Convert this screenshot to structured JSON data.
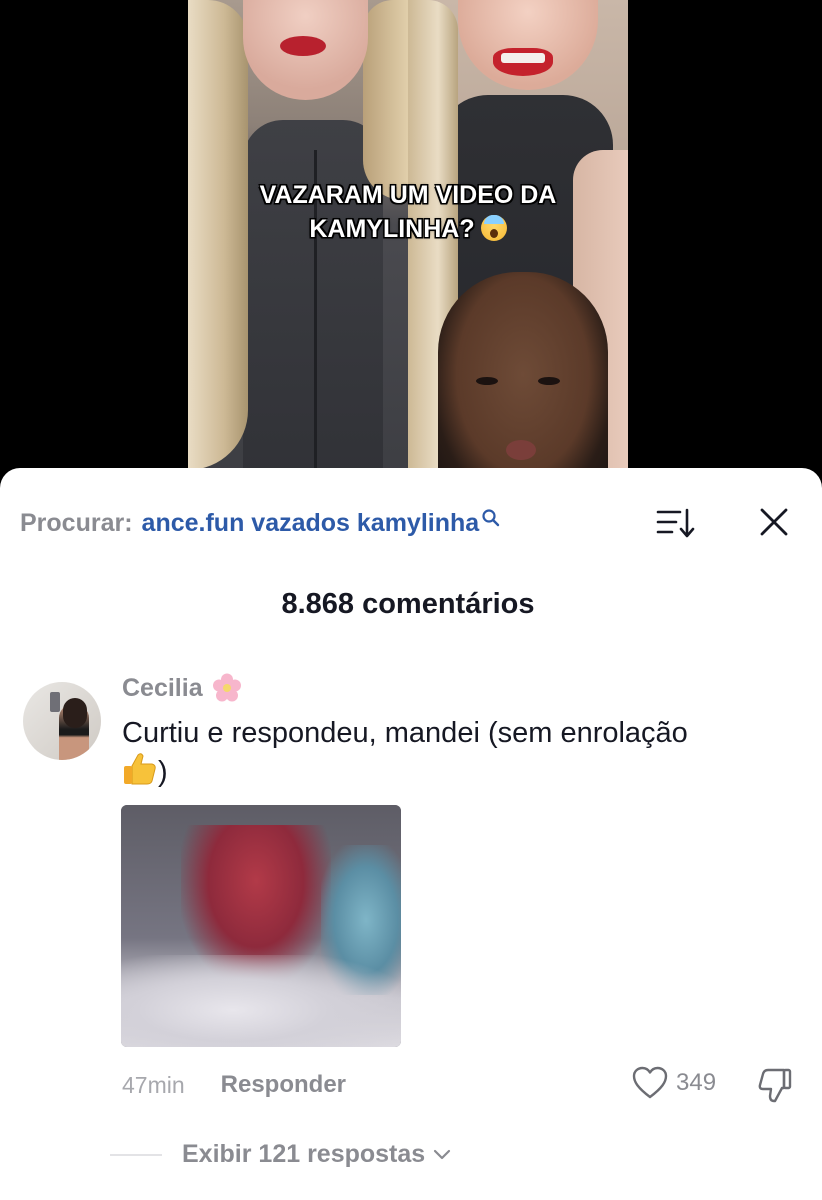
{
  "video": {
    "overlay_line1": "VAZARAM UM VIDEO DA",
    "overlay_line2": "KAMYLINHA?"
  },
  "search": {
    "prefix": "Procurar:",
    "query": "ance.fun vazados kamylinha"
  },
  "comments": {
    "count_title": "8.868 comentários"
  },
  "comment": {
    "username": "Cecilia",
    "text_before": "Curtiu e respondeu, mandei (sem enrolação",
    "text_after": ")",
    "time": "47min",
    "reply_label": "Responder",
    "likes": "349",
    "view_replies": "Exibir 121 respostas"
  },
  "colors": {
    "search_query": "#2d5aa8",
    "muted_text": "#8a8b91",
    "primary_text": "#161823",
    "sheet_bg": "#ffffff"
  },
  "icons": [
    "search-icon",
    "sort-icon",
    "close-icon",
    "flower-icon",
    "thumbs-up-emoji",
    "shocked-face-emoji",
    "heart-icon",
    "dislike-icon",
    "chevron-down-icon"
  ]
}
